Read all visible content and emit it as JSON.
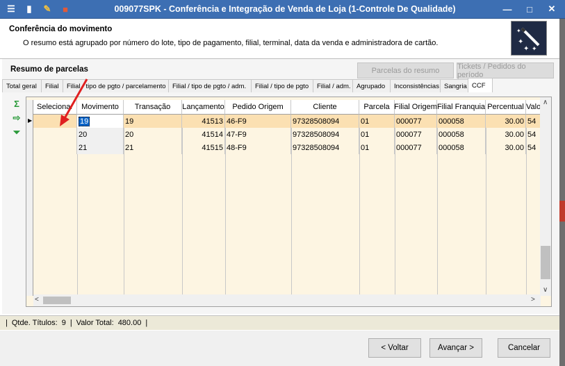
{
  "window": {
    "title": "009077SPK - Conferência e Integração de Venda de Loja (1-Controle De Qualidade)",
    "min_glyph": "—",
    "max_glyph": "□",
    "close_glyph": "✕"
  },
  "header": {
    "title": "Conferência do movimento",
    "description": "O resumo está agrupado por número do lote, tipo de pagamento, filial, terminal, data da venda e administradora de cartão."
  },
  "panel": {
    "title": "Resumo de parcelas",
    "btn_parcelas": "Parcelas do resumo",
    "btn_tickets": "Tickets / Pedidos do período"
  },
  "tabs": [
    {
      "label": "Total geral"
    },
    {
      "label": "Filial"
    },
    {
      "label": "Filial / tipo de pgto / parcelamento"
    },
    {
      "label": "Filial / tipo de pgto / adm."
    },
    {
      "label": "Filial / tipo de pgto"
    },
    {
      "label": "Filial / adm."
    },
    {
      "label": "Agrupado"
    },
    {
      "label": "Inconsistências"
    },
    {
      "label": "Sangria"
    },
    {
      "label": "CCF"
    }
  ],
  "grid": {
    "columns": [
      "Selecionar",
      "Movimento",
      "Transação",
      "Lançamento",
      "Pedido Origem",
      "Cliente",
      "Parcela",
      "Filial Origem",
      "Filial Franquia",
      "Percentual",
      "Valo"
    ],
    "rows": [
      {
        "selecionar": "",
        "movimento": "19",
        "transacao": "19",
        "lancamento": "41513",
        "pedido": "46-F9",
        "cliente": "97328508094",
        "parcela": "01",
        "filial_origem": "000077",
        "filial_franquia": "000058",
        "percentual": "30.00",
        "valor": "54"
      },
      {
        "selecionar": "",
        "movimento": "20",
        "transacao": "20",
        "lancamento": "41514",
        "pedido": "47-F9",
        "cliente": "97328508094",
        "parcela": "01",
        "filial_origem": "000077",
        "filial_franquia": "000058",
        "percentual": "30.00",
        "valor": "54"
      },
      {
        "selecionar": "",
        "movimento": "21",
        "transacao": "21",
        "lancamento": "41515",
        "pedido": "48-F9",
        "cliente": "97328508094",
        "parcela": "01",
        "filial_origem": "000077",
        "filial_franquia": "000058",
        "percentual": "30.00",
        "valor": "54"
      }
    ]
  },
  "status": {
    "qtde_label": "Qtde. Títulos:",
    "qtde_value": "9",
    "total_label": "Valor Total:",
    "total_value": "480.00"
  },
  "buttons": {
    "voltar": "< Voltar",
    "avancar": "Avançar >",
    "cancelar": "Cancelar"
  },
  "colors": {
    "titlebar": "#3d6fb3",
    "grid_bg": "#fdf5e2",
    "selected_row": "#fbe0b2",
    "arrow": "#e02020"
  }
}
